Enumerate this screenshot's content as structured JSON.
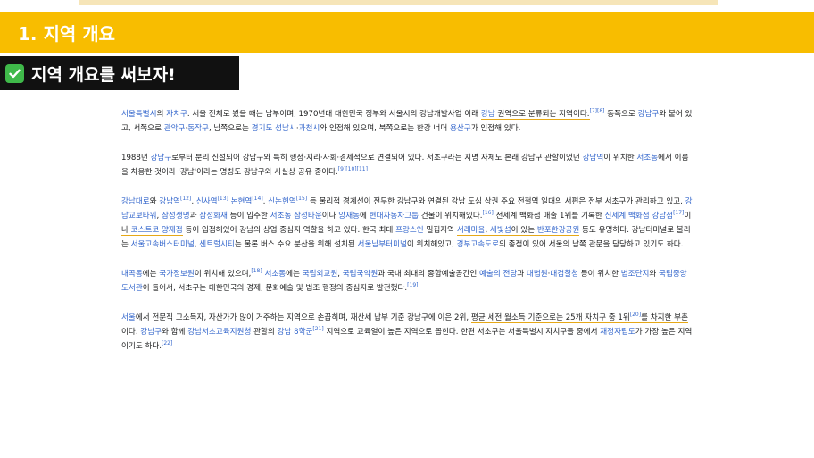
{
  "slide": {
    "section_title": "1. 지역 개요",
    "subheading": "지역 개요를 써보자!",
    "check_icon": "check-mark-icon"
  },
  "colors": {
    "header_band": "#f8bd00",
    "subheading_bg": "#111111",
    "link": "#3366cc",
    "highlight_underline": "#e6a817"
  },
  "article": {
    "p1": {
      "l1": "서울특별시",
      "t1": "의 ",
      "l2": "자치구",
      "t2": ". 서울 전체로 봤을 때는 남부이며, 1970년대 대한민국 정부와 서울시의 강남개발사업 이래 ",
      "l3": "강남",
      "t3": " 권역으로 분류되는 지역이다.",
      "r1": "[7][8]",
      "t4": " 동쪽으로 ",
      "l4": "강남구",
      "t5": "와 붙어 있고, 서쪽으로 ",
      "l5": "관악구",
      "t6": "·",
      "l6": "동작구",
      "t7": ", 남쪽으로는 ",
      "l7": "경기도",
      "t8": " ",
      "l8": "성남시",
      "t9": "·",
      "l9": "과천시",
      "t10": "와 인접해 있으며, 북쪽으로는 한강 너머 ",
      "l10": "용산구",
      "t11": "가 인접해 있다."
    },
    "p2": {
      "t1": "1988년 ",
      "l1": "강남구",
      "t2": "로부터 분리 신설되어 강남구와 특히 행정·지리·사회·경제적으로 연결되어 있다. 서초구라는 지명 자체도 본래 강남구 관할이었던 ",
      "l2": "강남역",
      "t3": "이 위치한 ",
      "l3": "서초동",
      "t4": "에서 이름을 차용한 것이라 '강남'이라는 명칭도 강남구와 사실상 공유 중이다.",
      "r1": "[9][10][11]"
    },
    "p3": {
      "l1": "강남대로",
      "t1": "와 ",
      "l2": "강남역",
      "r1": "[12]",
      "t2": ", ",
      "l3": "신사역",
      "r2": "[13]",
      "t3": " ",
      "l4": "논현역",
      "r3": "[14]",
      "t4": ", ",
      "l5": "신논현역",
      "r4": "[15]",
      "t5": " 등 물리적 경계선이 전무한 강남구와 연결된 강남 도심 상권 주요 전철역 일대의 서편은 전부 서초구가 관리하고 있고, ",
      "l6": "강남교보타워",
      "t6": ", ",
      "l7": "삼성생명",
      "t7": "과 ",
      "l8": "삼성화재",
      "t8": " 등이 입주한 ",
      "l9": "서초동 삼성타운",
      "t9": "이나 ",
      "l10": "양재동",
      "t10": "에 ",
      "l11": "현대자동차그룹",
      "t11": " 건물이 위치해있다.",
      "r5": "[16]",
      "t12": " 전세계 백화점 매출 1위를 기록한 ",
      "l12": "신세계 백화점 강남점",
      "r6": "[17]",
      "t13": "이나 ",
      "l13": "코스트코 양재점",
      "t14": " 등이 입점해있어 강남의 상업 중심지 역할을 하고 있다. 한국 최대 ",
      "l14": "프랑스인",
      "t15": " 밀집지역 ",
      "l15": "서래마을",
      "t16": ", ",
      "l16": "세빛섬",
      "t17": "이 있는 ",
      "l17": "반포한강공원",
      "t18": " 등도 유명하다. 강남터미널로 불리는 ",
      "l18": "서울고속버스터미널",
      "t19": ", ",
      "l19": "센트럴시티",
      "t20": "는 물론 버스 수요 분산을 위해 설치된 ",
      "l20": "서울남부터미널",
      "t21": "이 위치해있고, ",
      "l21": "경부고속도로",
      "t22": "의 종점이 있어 서울의 남쪽 관문을 담당하고 있기도 하다."
    },
    "p4": {
      "l1": "내곡동",
      "t1": "에는 ",
      "l2": "국가정보원",
      "t2": "이 위치해 있으며,",
      "r1": "[18]",
      "t3": " ",
      "l3": "서초동",
      "t4": "에는 ",
      "l4": "국립외교원",
      "t5": ", ",
      "l5": "국립국악원",
      "t6": "과 국내 최대의 종합예술공간인 ",
      "l6": "예술의 전당",
      "t7": "과 ",
      "l7": "대법원",
      "t8": "·",
      "l8": "대검찰청",
      "t9": " 등이 위치한 ",
      "l9": "법조단지",
      "t10": "와 ",
      "l10": "국립중앙도서관",
      "t11": "이 들어서, 서초구는 대한민국의 경제, 문화예술 및 법조 행정의 중심지로 발전했다.",
      "r2": "[19]"
    },
    "p5": {
      "l1": "서울",
      "t1": "에서 전문직 고소득자, 자산가가 많이 거주하는 지역으로 손꼽히며, 재산세 납부 기준 강남구에 이은 2위, ",
      "t2": "평균 세전 월소득 기준으로는 25개 자치구 중 1위",
      "r1": "[20]",
      "t3": "를 차지한 부촌이다. ",
      "l2": "강남구",
      "t4": "와 함께 ",
      "l3": "강남서초교육지원청",
      "t5": " 관할의 ",
      "l4": "강남 8학군",
      "r2": "[21]",
      "t6": " 지역으로 교육열이 높은 지역으로 꼽힌다.",
      "t7": " 한편 서초구는 서울특별시 자치구들 중에서 ",
      "l5": "재정자립도",
      "t8": "가 가장 높은 지역이기도 하다.",
      "r3": "[22]"
    }
  }
}
